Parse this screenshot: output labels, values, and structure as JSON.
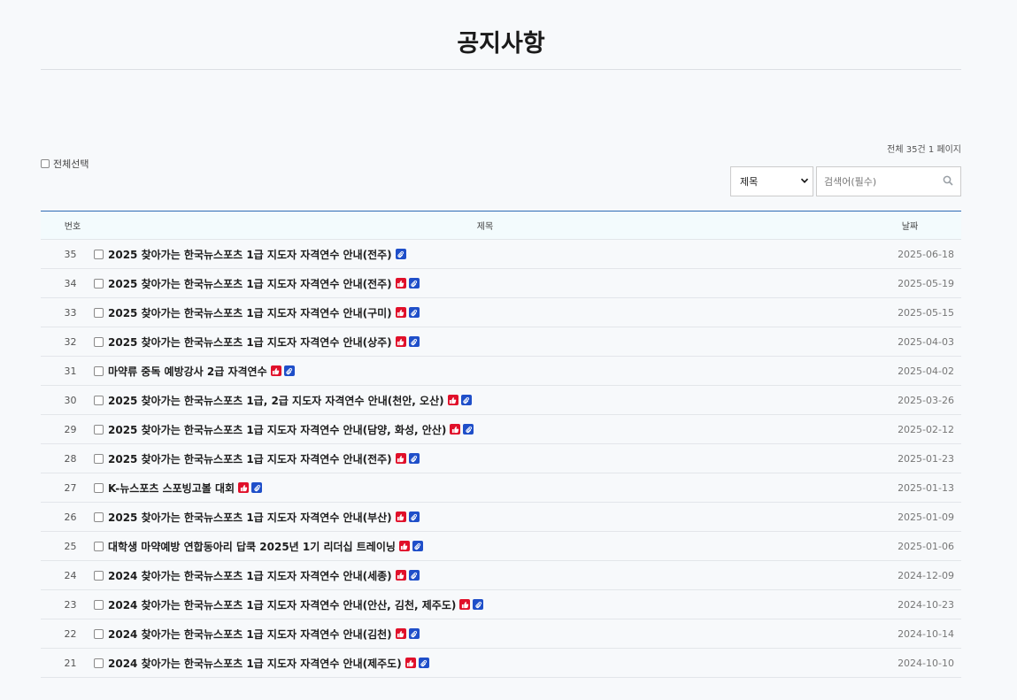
{
  "page": {
    "title": "공지사항"
  },
  "board_info": "전체 35건 1 페이지",
  "select_all_label": "전체선택",
  "search": {
    "field_value": "제목",
    "placeholder": "검색어(필수)"
  },
  "table": {
    "headers": {
      "num": "번호",
      "title": "제목",
      "date": "날짜"
    },
    "rows": [
      {
        "num": "35",
        "title": "2025 찾아가는 한국뉴스포츠 1급 지도자 자격연수 안내(전주)",
        "date": "2025-06-18",
        "hot": false,
        "file": true
      },
      {
        "num": "34",
        "title": "2025 찾아가는 한국뉴스포츠 1급 지도자 자격연수 안내(전주)",
        "date": "2025-05-19",
        "hot": true,
        "file": true
      },
      {
        "num": "33",
        "title": "2025 찾아가는 한국뉴스포츠 1급 지도자 자격연수 안내(구미)",
        "date": "2025-05-15",
        "hot": true,
        "file": true
      },
      {
        "num": "32",
        "title": "2025 찾아가는 한국뉴스포츠 1급 지도자 자격연수 안내(상주)",
        "date": "2025-04-03",
        "hot": true,
        "file": true
      },
      {
        "num": "31",
        "title": "마약류 중독 예방강사 2급 자격연수",
        "date": "2025-04-02",
        "hot": true,
        "file": true
      },
      {
        "num": "30",
        "title": "2025 찾아가는 한국뉴스포츠 1급, 2급 지도자 자격연수 안내(천안, 오산)",
        "date": "2025-03-26",
        "hot": true,
        "file": true
      },
      {
        "num": "29",
        "title": "2025 찾아가는 한국뉴스포츠 1급 지도자 자격연수 안내(담양, 화성, 안산)",
        "date": "2025-02-12",
        "hot": true,
        "file": true
      },
      {
        "num": "28",
        "title": "2025 찾아가는 한국뉴스포츠 1급 지도자 자격연수 안내(전주)",
        "date": "2025-01-23",
        "hot": true,
        "file": true
      },
      {
        "num": "27",
        "title": "K-뉴스포츠 스포빙고볼 대회",
        "date": "2025-01-13",
        "hot": true,
        "file": true
      },
      {
        "num": "26",
        "title": "2025 찾아가는 한국뉴스포츠 1급 지도자 자격연수 안내(부산)",
        "date": "2025-01-09",
        "hot": true,
        "file": true
      },
      {
        "num": "25",
        "title": "대학생 마약예방 연합동아리 답쿡 2025년 1기 리더십 트레이닝",
        "date": "2025-01-06",
        "hot": true,
        "file": true
      },
      {
        "num": "24",
        "title": "2024 찾아가는 한국뉴스포츠 1급 지도자 자격연수 안내(세종)",
        "date": "2024-12-09",
        "hot": true,
        "file": true
      },
      {
        "num": "23",
        "title": "2024 찾아가는 한국뉴스포츠 1급 지도자 자격연수 안내(안산, 김천, 제주도)",
        "date": "2024-10-23",
        "hot": true,
        "file": true
      },
      {
        "num": "22",
        "title": "2024 찾아가는 한국뉴스포츠 1급 지도자 자격연수 안내(김천)",
        "date": "2024-10-14",
        "hot": true,
        "file": true
      },
      {
        "num": "21",
        "title": "2024 찾아가는 한국뉴스포츠 1급 지도자 자격연수 안내(제주도)",
        "date": "2024-10-10",
        "hot": true,
        "file": true
      }
    ]
  },
  "colors": {
    "accent": "#2f6bb5",
    "hot_badge": "#e0102a",
    "file_badge": "#1f4fc9",
    "header_bg": "#f3fbfd"
  },
  "icons": {
    "hot": "thumbs-up-icon",
    "file": "paperclip-icon",
    "search": "search-icon"
  }
}
